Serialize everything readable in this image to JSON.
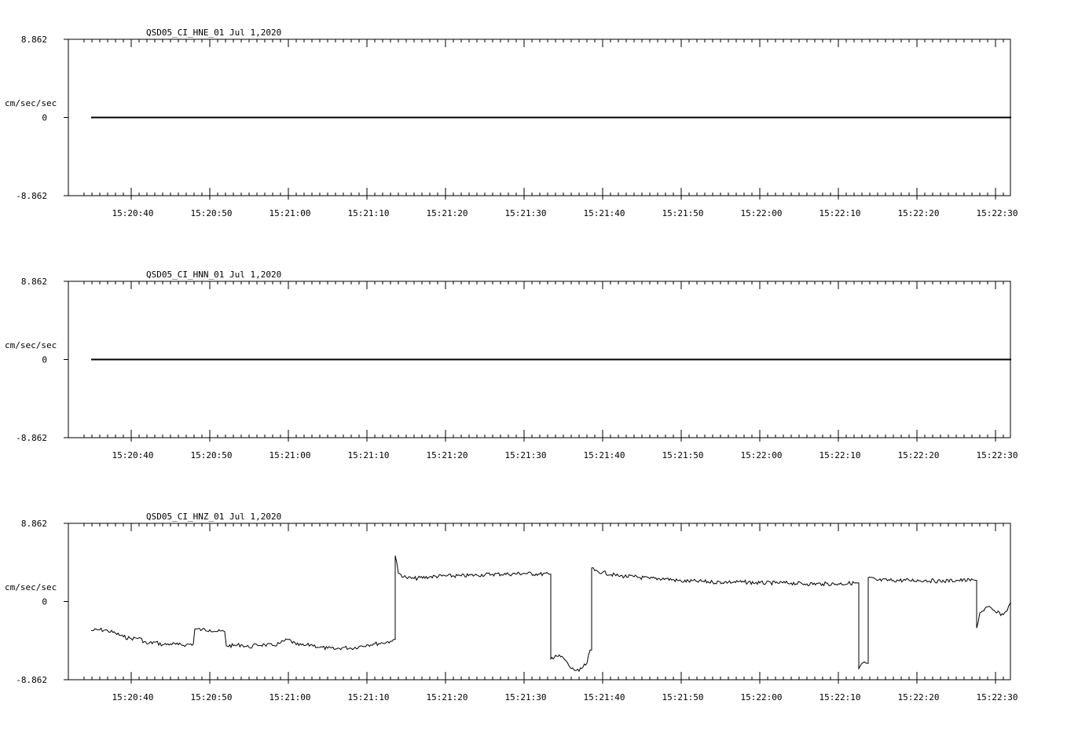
{
  "chart_data": [
    {
      "type": "line",
      "title": "QSD05_CI_HNE_01  Jul 1,2020",
      "ylabel": "cm/sec/sec",
      "ytick_labels": [
        "8.862",
        "0",
        "-8.862"
      ],
      "ylim": [
        -8.862,
        8.862
      ],
      "xtick_labels": [
        "15:20:40",
        "15:20:50",
        "15:21:00",
        "15:21:10",
        "15:21:20",
        "15:21:30",
        "15:21:40",
        "15:21:50",
        "15:22:00",
        "15:22:10",
        "15:22:20",
        "15:22:30"
      ],
      "x_range_seconds": [
        33.5,
        152.0
      ],
      "series": [
        {
          "x": [
            34.9,
            152.0
          ],
          "y": [
            0,
            0
          ]
        }
      ]
    },
    {
      "type": "line",
      "title": "QSD05_CI_HNN_01  Jul 1,2020",
      "ylabel": "cm/sec/sec",
      "ytick_labels": [
        "8.862",
        "0",
        "-8.862"
      ],
      "ylim": [
        -8.862,
        8.862
      ],
      "xtick_labels": [
        "15:20:40",
        "15:20:50",
        "15:21:00",
        "15:21:10",
        "15:21:20",
        "15:21:30",
        "15:21:40",
        "15:21:50",
        "15:22:00",
        "15:22:10",
        "15:22:20",
        "15:22:30"
      ],
      "x_range_seconds": [
        33.5,
        152.0
      ],
      "series": [
        {
          "x": [
            34.9,
            152.0
          ],
          "y": [
            0,
            0
          ]
        }
      ]
    },
    {
      "type": "line",
      "title": "QSD05_CI_HNZ_01  Jul 1,2020",
      "ylabel": "cm/sec/sec",
      "ytick_labels": [
        "8.862",
        "0",
        "-8.862"
      ],
      "ylim": [
        -8.862,
        8.862
      ],
      "xtick_labels": [
        "15:20:40",
        "15:20:50",
        "15:21:00",
        "15:21:10",
        "15:21:20",
        "15:21:30",
        "15:21:40",
        "15:21:50",
        "15:22:00",
        "15:22:10",
        "15:22:20",
        "15:22:30"
      ],
      "x_range_seconds": [
        33.5,
        152.0
      ],
      "series": [
        {
          "x": [
            34.9,
            36.0,
            37.0,
            38.0,
            39.0,
            40.0,
            41.0,
            42.0,
            43.0,
            44.0,
            45.0,
            46.0,
            47.0,
            47.9,
            48.1,
            49.0,
            50.0,
            51.0,
            51.9,
            52.1,
            53.0,
            54.0,
            55.0,
            56.0,
            57.0,
            58.0,
            59.0,
            60.0,
            61.0,
            62.0,
            63.0,
            64.0,
            65.0,
            66.0,
            67.0,
            68.0,
            69.0,
            70.0,
            71.0,
            72.0,
            73.0,
            73.4,
            73.6,
            74.0,
            75.0,
            76.0,
            78.0,
            80.0,
            82.0,
            84.0,
            86.0,
            88.0,
            90.0,
            92.0,
            93.2,
            93.4,
            94.0,
            95.0,
            96.0,
            97.0,
            98.0,
            98.4,
            98.6,
            99.0,
            100.0,
            102.0,
            104.0,
            106.0,
            108.0,
            110.0,
            112.0,
            114.0,
            116.0,
            118.0,
            120.0,
            122.0,
            124.0,
            126.0,
            128.0,
            130.0,
            132.0,
            132.4,
            132.6,
            133.0,
            133.6,
            133.8,
            135.0,
            137.0,
            139.0,
            141.0,
            143.0,
            145.0,
            147.4,
            147.6,
            148.0,
            149.0,
            150.0,
            151.0,
            152.0
          ],
          "y": [
            -3.3,
            -3.2,
            -3.3,
            -3.6,
            -4.0,
            -4.2,
            -4.1,
            -4.8,
            -4.6,
            -4.9,
            -4.8,
            -4.9,
            -4.9,
            -4.8,
            -3.1,
            -3.2,
            -3.2,
            -3.4,
            -3.4,
            -5.0,
            -5.0,
            -4.9,
            -5.2,
            -4.9,
            -4.9,
            -5.0,
            -4.7,
            -4.3,
            -4.9,
            -5.0,
            -4.9,
            -5.2,
            -5.3,
            -5.4,
            -5.2,
            -5.3,
            -5.1,
            -4.9,
            -4.8,
            -4.7,
            -4.5,
            -4.3,
            5.2,
            3.2,
            2.7,
            2.6,
            2.8,
            2.9,
            2.9,
            3.0,
            3.1,
            3.1,
            3.2,
            3.1,
            3.1,
            -6.5,
            -6.1,
            -6.4,
            -7.6,
            -7.9,
            -7.0,
            -5.5,
            3.8,
            3.5,
            3.3,
            2.9,
            2.8,
            2.6,
            2.6,
            2.3,
            2.3,
            2.2,
            2.2,
            2.2,
            2.1,
            2.1,
            2.1,
            2.0,
            2.0,
            2.0,
            2.1,
            2.1,
            -7.6,
            -7.0,
            -7.0,
            2.7,
            2.4,
            2.4,
            2.4,
            2.4,
            2.3,
            2.4,
            2.4,
            -3.0,
            -1.3,
            -0.6,
            -1.2,
            -1.5,
            -0.2
          ]
        }
      ]
    }
  ]
}
